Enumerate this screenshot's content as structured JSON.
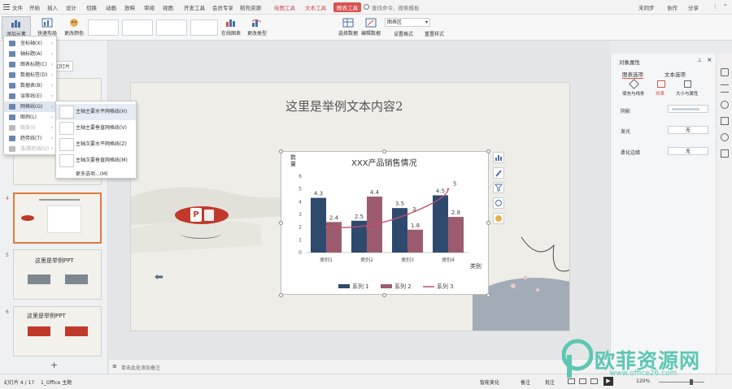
{
  "menubar": {
    "items": [
      "文件",
      "开始",
      "插入",
      "设计",
      "切换",
      "动画",
      "放映",
      "审阅",
      "视图",
      "开发工具",
      "会员专享",
      "稻壳资源",
      "绘图工具",
      "文本工具",
      "图表工具"
    ],
    "search": "查找命令、搜索模板",
    "unsynced": "未同步",
    "collab": "协作",
    "share": "分享"
  },
  "ribbon": {
    "add_element": "添加元素",
    "quick_layout": "快速布局",
    "change_color": "更改颜色",
    "online_chart": "在线图表",
    "change_type": "更改类型",
    "select_data": "选择数据",
    "edit_data": "编辑数据",
    "chart_area": "图表区",
    "set_format": "设置格式",
    "reset_style": "重置样式"
  },
  "left_panel": {
    "tab": "幻灯片",
    "slide_numbers": [
      "4",
      "5",
      "6"
    ],
    "slide5_title": "这里是举例PPT",
    "slide6_title": "这里是举例PPT",
    "add_slide": "+"
  },
  "add_element_menu": {
    "items": [
      "坐标轴(X)",
      "轴标题(A)",
      "图表标题(C)",
      "数据标签(D)",
      "数据表(B)",
      "误差线(E)",
      "网格线(G)",
      "图例(L)",
      "线条(I)",
      "趋势线(T)",
      "涨/跌柱线(U)"
    ]
  },
  "gridline_submenu": {
    "items": [
      "主轴主要水平网格线(H)",
      "主轴主要垂直网格线(V)",
      "主轴次要水平网格线(Z)",
      "主轴次要垂直网格线(M)"
    ],
    "more": "更多选项...(M)"
  },
  "slide": {
    "title": "这里是举例文本内容2"
  },
  "chart_data": {
    "type": "bar",
    "title": "XXX产品销售情况",
    "ylabel": "数量",
    "xlabel": "类别",
    "ylim": [
      0,
      6
    ],
    "yticks": [
      "0",
      "1",
      "2",
      "3",
      "4",
      "5",
      "6"
    ],
    "categories": [
      "类别1",
      "类别2",
      "类别3",
      "类别4"
    ],
    "series": [
      {
        "name": "系列 1",
        "type": "bar",
        "values": [
          4.3,
          2.5,
          3.5,
          4.5
        ],
        "color": "#2d4a6e"
      },
      {
        "name": "系列 2",
        "type": "bar",
        "values": [
          2.4,
          4.4,
          1.8,
          2.8
        ],
        "color": "#9c5b6e"
      },
      {
        "name": "系列 3",
        "type": "line",
        "values": [
          2,
          2,
          3,
          5
        ],
        "color": "#c0506b"
      }
    ],
    "data_labels": [
      {
        "x": "类别1",
        "text": "4.3"
      },
      {
        "x": "类别1",
        "text": "2.4"
      },
      {
        "x": "类别2",
        "text": "2.5"
      },
      {
        "x": "类别2",
        "text": "4.4"
      },
      {
        "x": "类别3",
        "text": "3.5"
      },
      {
        "x": "类别3",
        "text": "1.8"
      },
      {
        "x": "类别3",
        "text": "3"
      },
      {
        "x": "类别4",
        "text": "4.5"
      },
      {
        "x": "类别4",
        "text": "2.8"
      },
      {
        "x": "类别4",
        "text": "5"
      }
    ],
    "legend_position": "bottom",
    "grid": false
  },
  "right_pane": {
    "title": "对象属性",
    "tab_chart_options": "图表选项",
    "tab_text_options": "文本选项",
    "sub_fill": "填充与线条",
    "sub_effect": "效果",
    "sub_size": "大小与属性",
    "shadow": "阴影",
    "glow": "发光",
    "glow_value": "无",
    "soft_edge": "柔化边缘",
    "soft_value": "无"
  },
  "notes": {
    "placeholder": "单击此处添加备注"
  },
  "status": {
    "slide_count": "幻灯片 4 / 17",
    "theme": "1_Office 主题",
    "beautify": "智能美化",
    "notes": "备注",
    "comment": "批注",
    "zoom": "120%"
  },
  "watermark": {
    "brand": "欧菲资源网",
    "url": "www.office26.com"
  }
}
